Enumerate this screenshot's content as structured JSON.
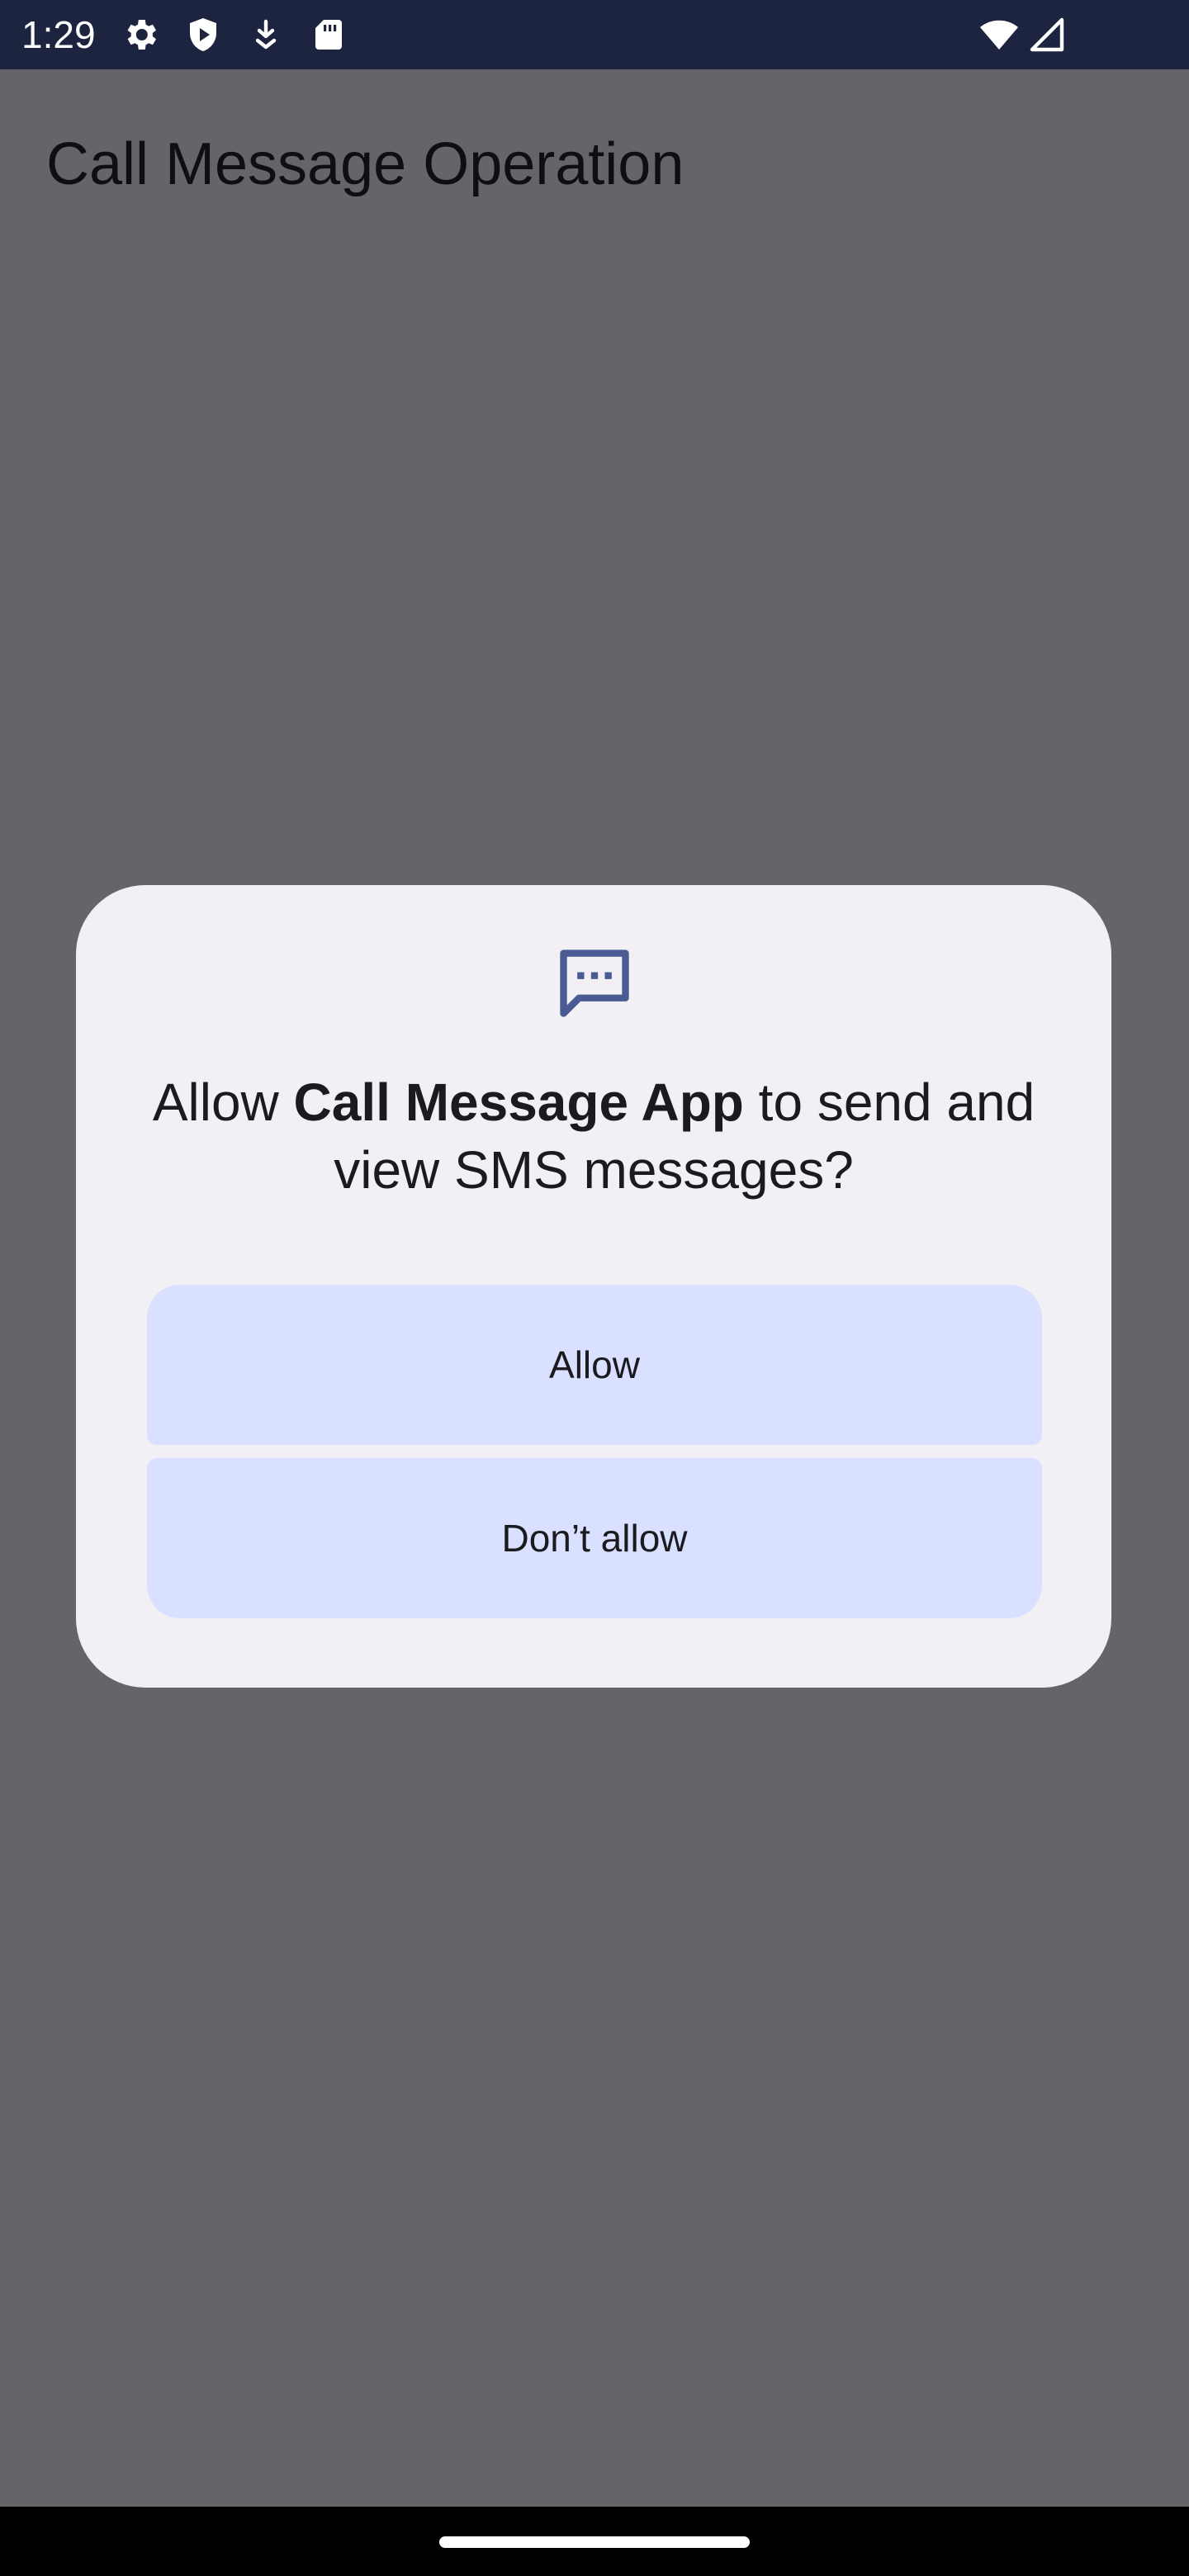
{
  "status_bar": {
    "time": "1:29",
    "icons": [
      "gear-icon",
      "shield-play-icon",
      "download-icon",
      "sd-card-icon",
      "wifi-icon",
      "cell-signal-icon"
    ]
  },
  "app": {
    "title": "Call Message Operation"
  },
  "dialog": {
    "icon": "sms-message-icon",
    "title_prefix": "Allow ",
    "title_app_name": "Call Message App",
    "title_suffix": " to send and view SMS messages?",
    "allow_label": "Allow",
    "deny_label": "Don’t allow"
  },
  "colors": {
    "status_bar_bg": "#1d2440",
    "scrim": "#666468",
    "dialog_bg": "#f2f0f5",
    "button_bg": "#dae0ff",
    "icon_accent": "#4a5a92"
  }
}
